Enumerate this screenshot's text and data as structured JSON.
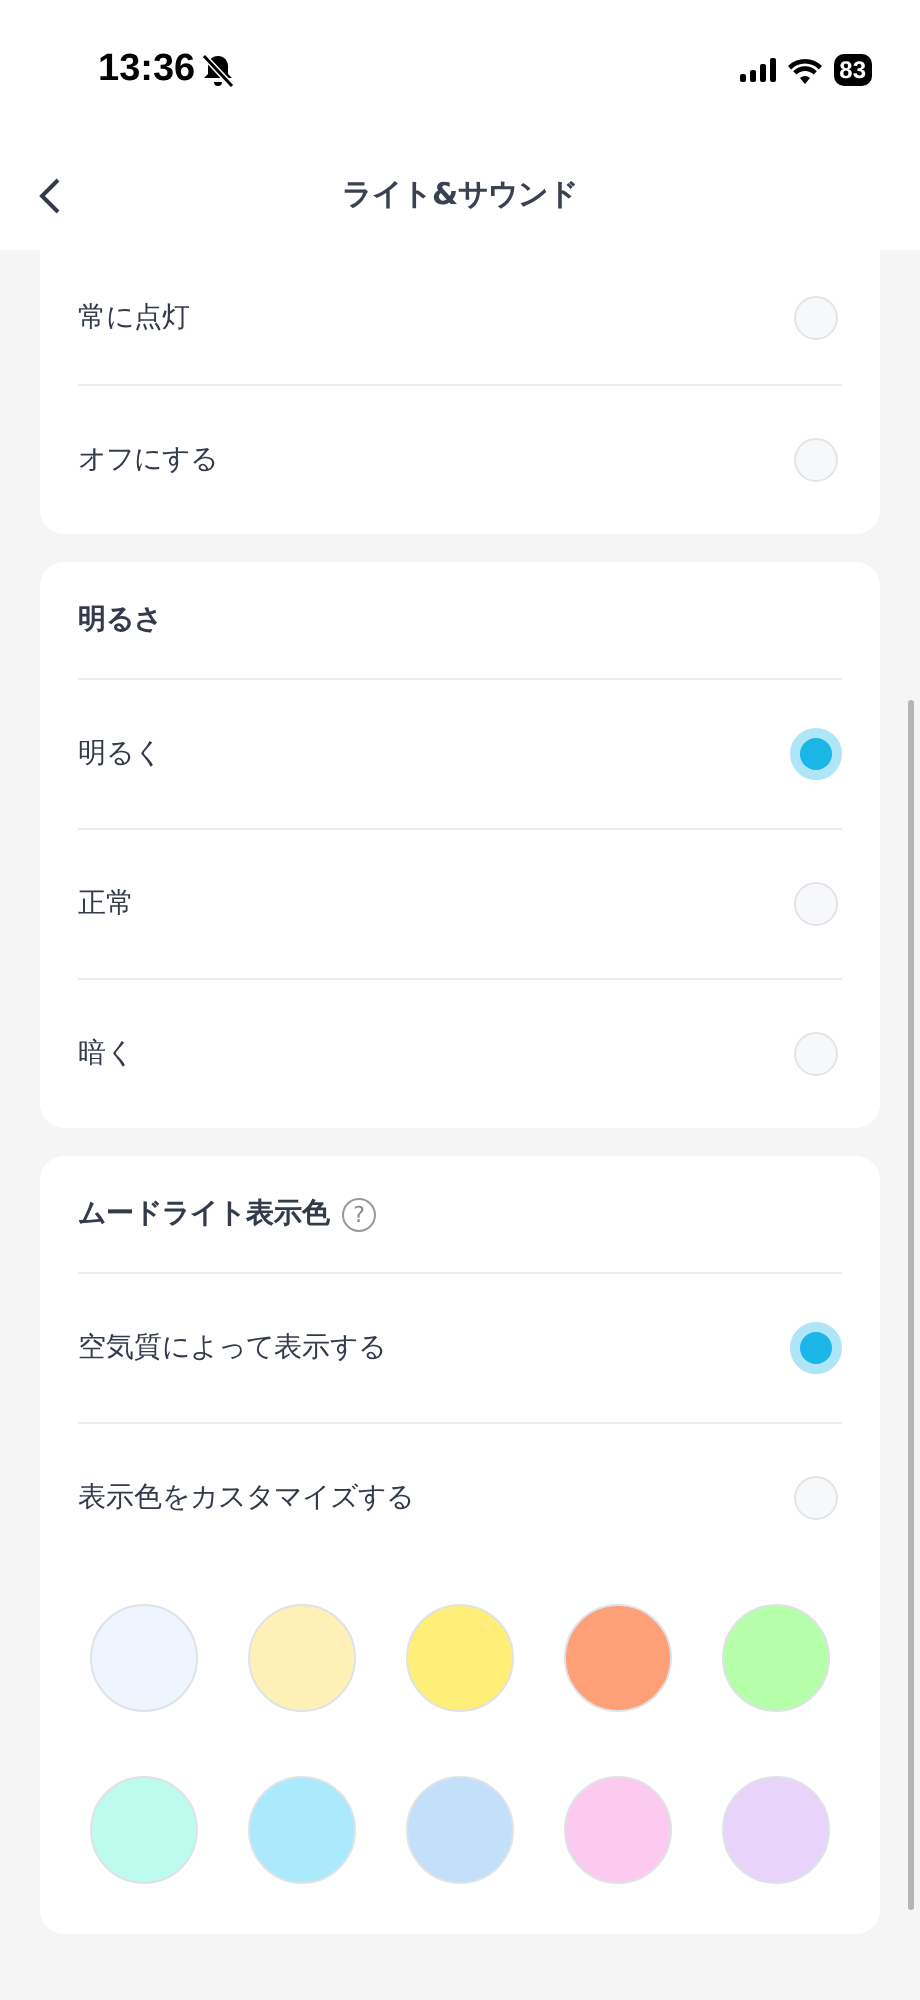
{
  "status_bar": {
    "time": "13:36",
    "battery": "83"
  },
  "header": {
    "title": "ライト&サウンド"
  },
  "sections": [
    {
      "options": [
        {
          "label": "常に点灯",
          "selected": false
        },
        {
          "label": "オフにする",
          "selected": false
        }
      ]
    },
    {
      "title": "明るさ",
      "options": [
        {
          "label": "明るく",
          "selected": true
        },
        {
          "label": "正常",
          "selected": false
        },
        {
          "label": "暗く",
          "selected": false
        }
      ]
    },
    {
      "title": "ムードライト表示色",
      "help": "?",
      "options": [
        {
          "label": "空気質によって表示する",
          "selected": true
        },
        {
          "label": "表示色をカスタマイズする",
          "selected": false
        }
      ],
      "swatches": [
        {
          "color": "#eef5ff"
        },
        {
          "color": "#fff0b8"
        },
        {
          "color": "#ffee78"
        },
        {
          "color": "#ff9f78"
        },
        {
          "color": "#b5ffab"
        },
        {
          "color": "#bdfbee"
        },
        {
          "color": "#abeafc"
        },
        {
          "color": "#c3e0fa"
        },
        {
          "color": "#fccaee"
        },
        {
          "color": "#e8d3fb"
        }
      ]
    }
  ]
}
